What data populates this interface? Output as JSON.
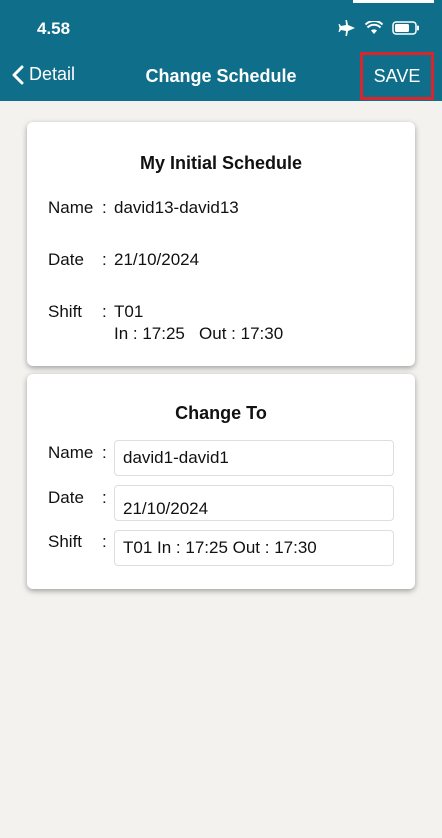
{
  "status": {
    "time": "4.58"
  },
  "nav": {
    "back_label": "Detail",
    "title": "Change Schedule",
    "save_label": "SAVE"
  },
  "initial": {
    "title": "My Initial Schedule",
    "name_label": "Name",
    "name_value": "david13-david13",
    "date_label": "Date",
    "date_value": "21/10/2024",
    "shift_label": "Shift",
    "shift_code": "T01",
    "shift_times": "In : 17:25   Out : 17:30"
  },
  "change": {
    "title": "Change To",
    "name_label": "Name",
    "name_value": "david1-david1",
    "date_label": "Date",
    "date_value": "21/10/2024",
    "shift_label": "Shift",
    "shift_value": "T01 In : 17:25 Out : 17:30"
  },
  "colors": {
    "header": "#0f6f8a",
    "highlight": "#d9262c",
    "background": "#f3f2ef"
  }
}
